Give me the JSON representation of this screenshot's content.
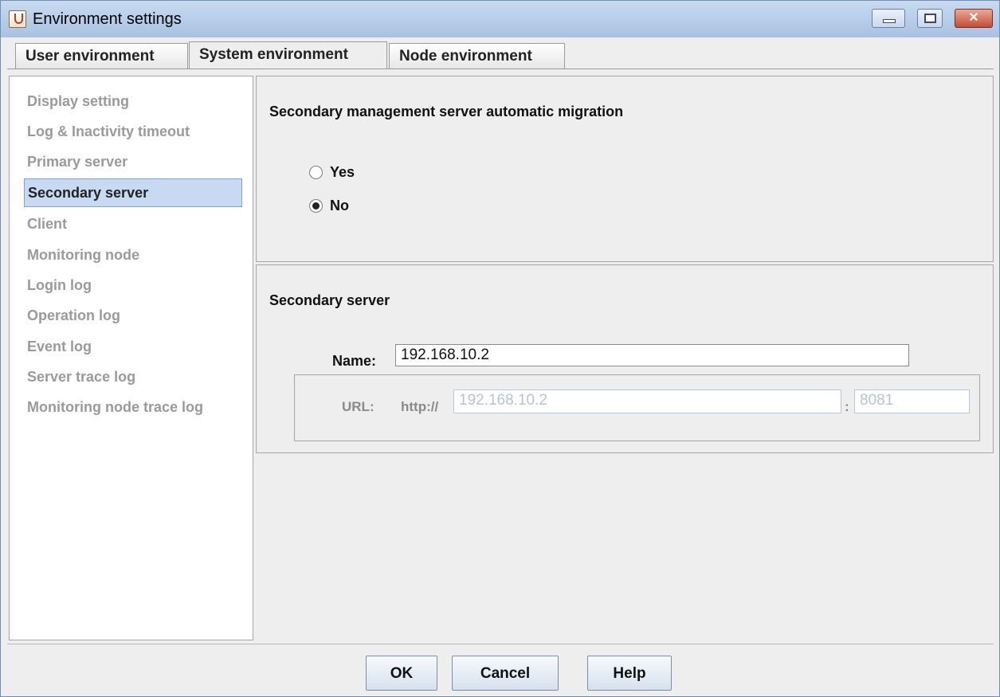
{
  "window": {
    "title": "Environment settings",
    "close_glyph": "✕"
  },
  "tabs": [
    {
      "label": "User environment"
    },
    {
      "label": "System environment"
    },
    {
      "label": "Node environment"
    }
  ],
  "active_tab": "System environment",
  "sidebar": {
    "items": [
      {
        "label": "Display setting"
      },
      {
        "label": "Log & Inactivity timeout"
      },
      {
        "label": "Primary server"
      },
      {
        "label": "Secondary server"
      },
      {
        "label": "Client"
      },
      {
        "label": "Monitoring node"
      },
      {
        "label": "Login log"
      },
      {
        "label": "Operation log"
      },
      {
        "label": "Event log"
      },
      {
        "label": "Server trace log"
      },
      {
        "label": "Monitoring node trace log"
      }
    ],
    "selected": "Secondary server"
  },
  "migration_panel": {
    "title": "Secondary management server automatic migration",
    "options": [
      {
        "label": "Yes",
        "selected": false
      },
      {
        "label": "No",
        "selected": true
      }
    ]
  },
  "secondary_panel": {
    "title": "Secondary server",
    "name_label": "Name:",
    "name_value": "192.168.10.2",
    "url_label": "URL:",
    "url_scheme": "http://",
    "url_host": "192.168.10.2",
    "url_colon": ":",
    "url_port": "8081"
  },
  "buttons": {
    "ok": "OK",
    "cancel": "Cancel",
    "help": "Help"
  }
}
